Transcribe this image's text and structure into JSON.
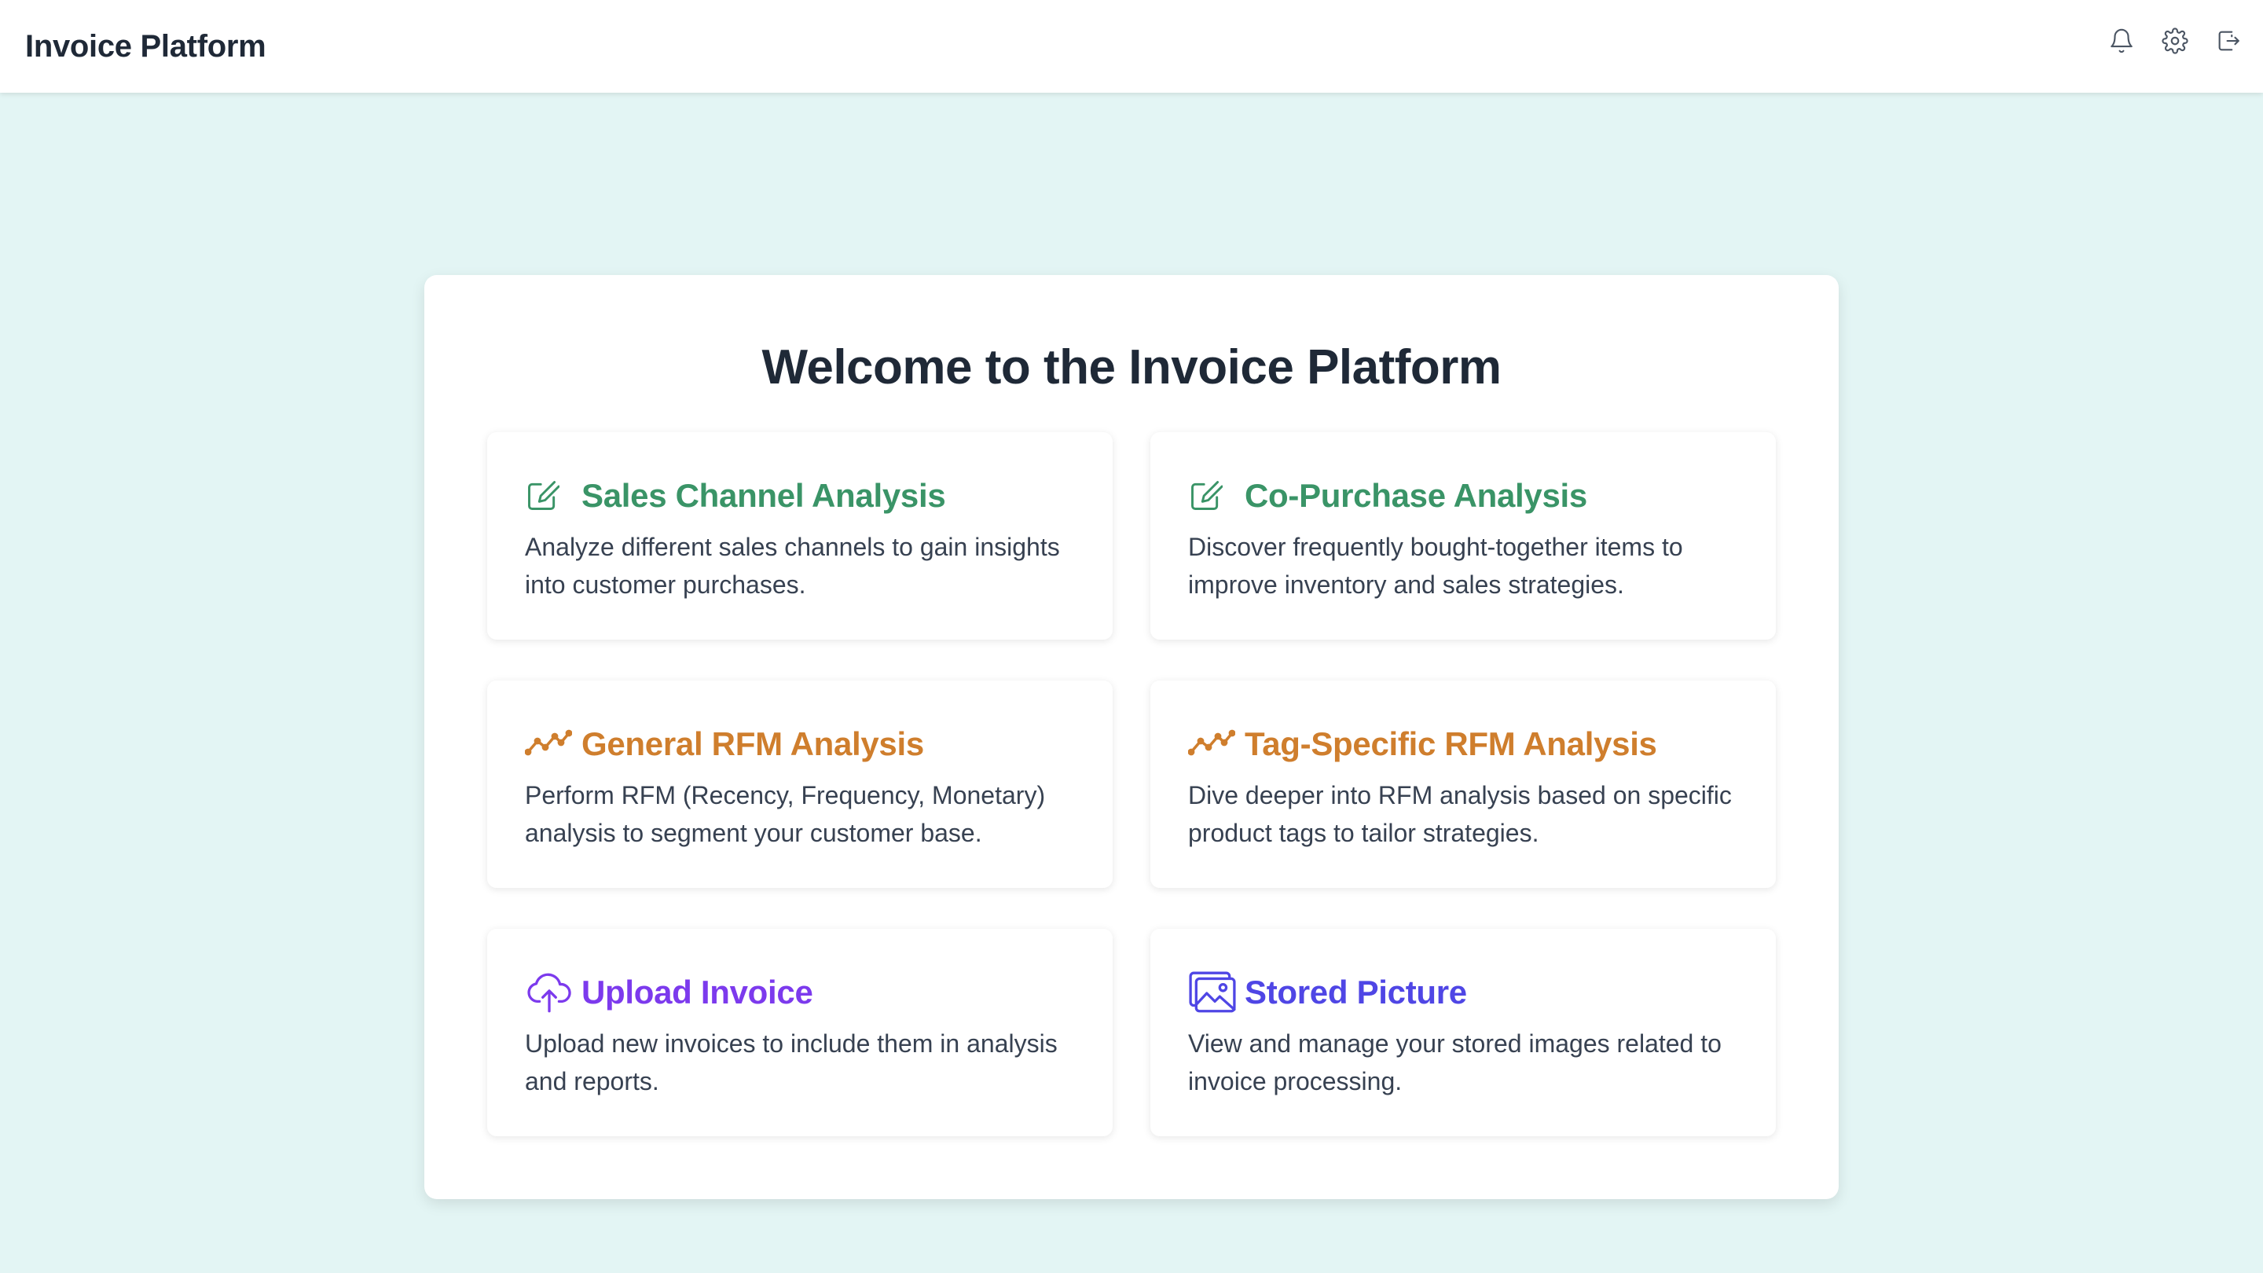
{
  "header": {
    "title": "Invoice Platform",
    "icons": [
      "bell-icon",
      "gear-icon",
      "logout-icon"
    ]
  },
  "main": {
    "heading": "Welcome to the Invoice Platform",
    "cards": [
      {
        "title": "Sales Channel Analysis",
        "description": "Analyze different sales channels to gain insights into customer purchases.",
        "icon": "edit-icon",
        "color": "#3a9467"
      },
      {
        "title": "Co-Purchase Analysis",
        "description": "Discover frequently bought-together items to improve inventory and sales strategies.",
        "icon": "edit-icon",
        "color": "#3a9467"
      },
      {
        "title": "General RFM Analysis",
        "description": "Perform RFM (Recency, Frequency, Monetary) analysis to segment your customer base.",
        "icon": "trend-line-icon",
        "color": "#cf7e2d"
      },
      {
        "title": "Tag-Specific RFM Analysis",
        "description": "Dive deeper into RFM analysis based on specific product tags to tailor strategies.",
        "icon": "trend-line-icon",
        "color": "#cf7e2d"
      },
      {
        "title": "Upload Invoice",
        "description": "Upload new invoices to include them in analysis and reports.",
        "icon": "cloud-upload-icon",
        "color": "#7c3aed"
      },
      {
        "title": "Stored Picture",
        "description": "View and manage your stored images related to invoice processing.",
        "icon": "images-icon",
        "color": "#4f46e5"
      }
    ]
  },
  "colors": {
    "background": "#e3f5f4",
    "heading": "#1f2937",
    "body_text": "#374151"
  }
}
